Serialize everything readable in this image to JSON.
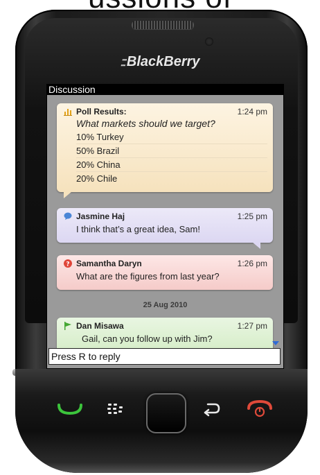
{
  "overlay_text": "ussions of",
  "device": {
    "brand": "BlackBerry"
  },
  "screen": {
    "title": "Discussion",
    "poll": {
      "title": "Poll Results:",
      "time": "1:24 pm",
      "question": "What markets should we target?",
      "options": [
        "10% Turkey",
        "50% Brazil",
        "20% China",
        "20% Chile"
      ]
    },
    "messages": [
      {
        "sender": "Jasmine Haj",
        "time": "1:25 pm",
        "text": "I think that’s a great idea, Sam!",
        "icon": "chat-bubble-icon",
        "color": "#4a86d6"
      },
      {
        "sender": "Samantha Daryn",
        "time": "1:26 pm",
        "text": "What are the figures from last year?",
        "icon": "question-icon",
        "color": "#e0463a"
      },
      {
        "sender": "Dan Misawa",
        "time": "1:27 pm",
        "text": "Gail, can you follow up with Jim?",
        "icon": "flag-icon",
        "color": "#45a834"
      }
    ],
    "date_separator": "25 Aug 2010",
    "reply_hint": "Press R to reply"
  },
  "keys": [
    "call-icon",
    "blackberry-menu-icon",
    "trackpad",
    "back-icon",
    "end-call-icon"
  ],
  "colors": {
    "call": "#3cc43c",
    "end": "#e04a3a",
    "poll_icon": "#e2a21a"
  }
}
